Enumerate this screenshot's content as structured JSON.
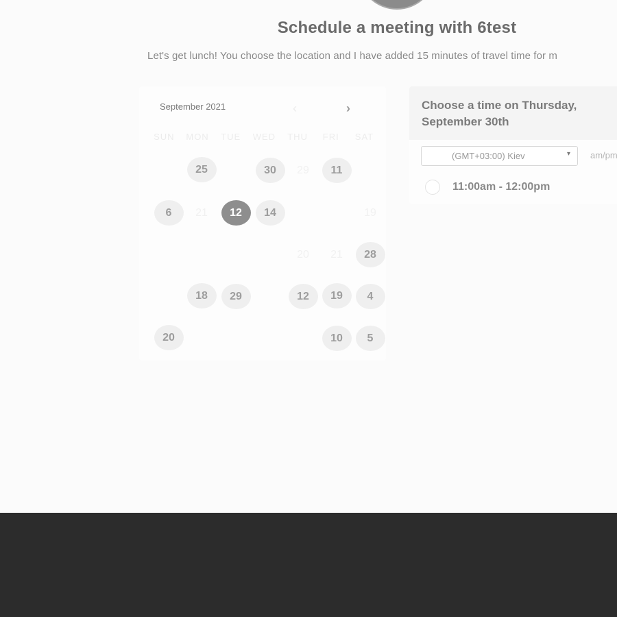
{
  "header": {
    "title": "Schedule a meeting with 6test",
    "subtitle": "Let's get lunch! You choose the location and I have added 15 minutes of travel time for m"
  },
  "calendar": {
    "month_label": "September 2021",
    "prev_icon": "chevron-left-icon",
    "next_icon": "chevron-right-icon",
    "prev_glyph": "‹",
    "next_glyph": "›",
    "weekdays": [
      "SUN",
      "MON",
      "TUE",
      "WED",
      "THU",
      "FRI",
      "SAT"
    ],
    "days": [
      {
        "label": "25",
        "state": "available"
      },
      {
        "label": "30",
        "state": "available"
      },
      {
        "label": "29",
        "state": "faint"
      },
      {
        "label": "11",
        "state": "available"
      },
      {
        "label": "6",
        "state": "available"
      },
      {
        "label": "21",
        "state": "faint"
      },
      {
        "label": "12",
        "state": "selected"
      },
      {
        "label": "14",
        "state": "available"
      },
      {
        "label": "19",
        "state": "faint"
      },
      {
        "label": "20",
        "state": "faint"
      },
      {
        "label": "21",
        "state": "faint"
      },
      {
        "label": "28",
        "state": "available"
      },
      {
        "label": "18",
        "state": "available"
      },
      {
        "label": "29",
        "state": "available"
      },
      {
        "label": "12",
        "state": "available"
      },
      {
        "label": "19",
        "state": "available"
      },
      {
        "label": "4",
        "state": "available"
      },
      {
        "label": "20",
        "state": "available"
      },
      {
        "label": "10",
        "state": "available"
      },
      {
        "label": "5",
        "state": "available"
      }
    ]
  },
  "times": {
    "heading": "Choose a time on Thursday, September 30th",
    "timezone_value": "(GMT+03:00) Kiev",
    "timezone_icon": "caret-down-icon",
    "caret_glyph": "▾",
    "ampm_label": "am/pm",
    "slots": [
      {
        "label": "11:00am - 12:00pm",
        "selected": false
      }
    ]
  }
}
